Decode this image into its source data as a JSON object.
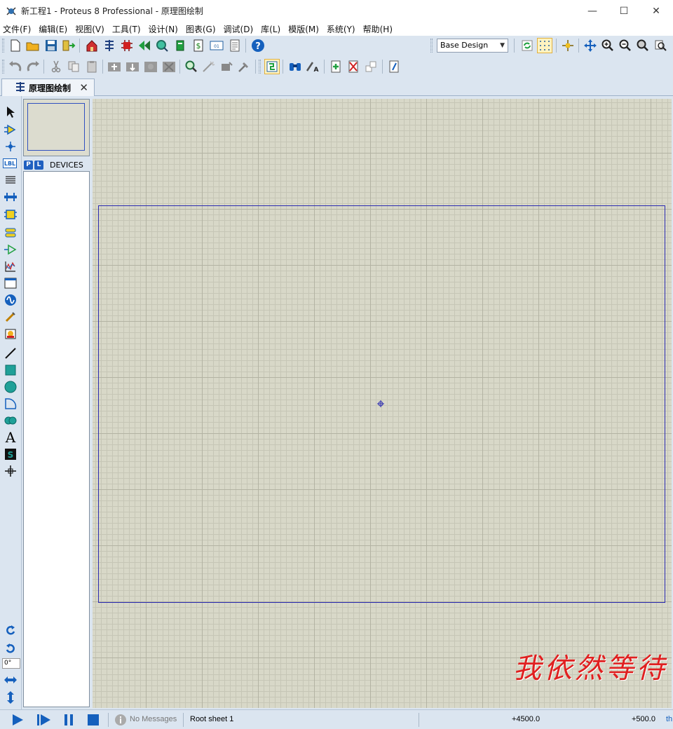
{
  "window": {
    "title": "新工程1 - Proteus 8 Professional - 原理图绘制",
    "controls": {
      "minimize": "—",
      "maximize": "☐",
      "close": "✕"
    }
  },
  "menu": [
    "文件(F)",
    "编辑(E)",
    "视图(V)",
    "工具(T)",
    "设计(N)",
    "图表(G)",
    "调试(D)",
    "库(L)",
    "模版(M)",
    "系统(Y)",
    "帮助(H)"
  ],
  "toolbar": {
    "design_select": "Base Design"
  },
  "tab": {
    "label": "原理图绘制",
    "close": "✕"
  },
  "panel": {
    "p_button": "P",
    "l_button": "L",
    "devices_label": "DEVICES"
  },
  "left_tools": {
    "label_tool": "LBL",
    "rotation_value": "0°"
  },
  "canvas": {
    "watermark": "我依然等待"
  },
  "status": {
    "messages": "No Messages",
    "sheet": "Root sheet 1",
    "coord_x": "+4500.0",
    "coord_y": "+500.0",
    "unit": "th"
  },
  "colors": {
    "chrome": "#dbe5f0",
    "canvas": "#d8d8c8",
    "sheet_border": "#2a2ab0",
    "accent_blue": "#1560bd"
  }
}
